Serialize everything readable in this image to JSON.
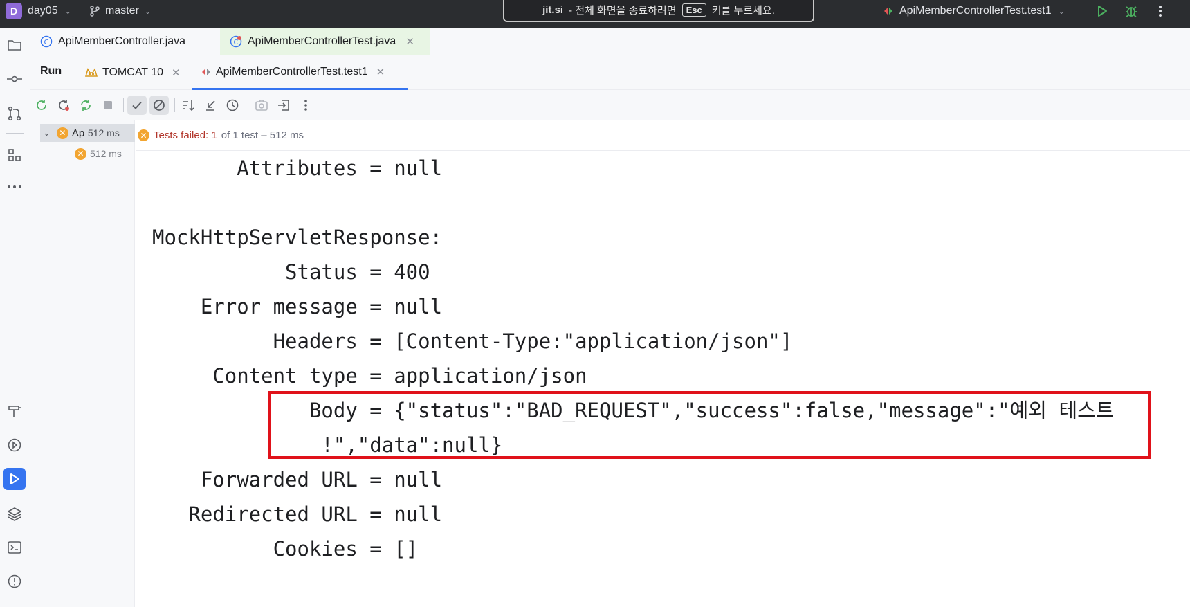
{
  "titlebar": {
    "project_initial": "D",
    "project_name": "day05",
    "branch": "master",
    "fullscreen_notice": {
      "site": "jit.si",
      "before": "- 전체 화면을 종료하려면",
      "key": "Esc",
      "after": "키를 누르세요."
    },
    "run_config": "ApiMemberControllerTest.test1"
  },
  "editor_tabs": [
    {
      "label": "ApiMemberController.java",
      "selected": false
    },
    {
      "label": "ApiMemberControllerTest.java",
      "selected": true
    }
  ],
  "run_panel": {
    "title": "Run",
    "tabs": [
      {
        "label": "TOMCAT 10"
      },
      {
        "label": "ApiMemberControllerTest.test1",
        "selected": true
      }
    ]
  },
  "test_tree": [
    {
      "name": "ApiMemberControllerTest",
      "duration": "512 ms",
      "expanded": true
    },
    {
      "name": "",
      "duration": "512 ms"
    }
  ],
  "status": {
    "failed_label": "Tests failed: 1",
    "rest": "of 1 test – 512 ms"
  },
  "console_lines": [
    "       Attributes = null",
    "",
    "MockHttpServletResponse:",
    "           Status = 400",
    "    Error message = null",
    "          Headers = [Content-Type:\"application/json\"]",
    "     Content type = application/json",
    "             Body = {\"status\":\"BAD_REQUEST\",\"success\":false,\"message\":\"예외 테스트",
    "              !\",\"data\":null}",
    "    Forwarded URL = null",
    "   Redirected URL = null",
    "          Cookies = []"
  ],
  "colors": {
    "accent": "#3574f0",
    "fail": "#f2a531",
    "highlight_box": "#e0121a",
    "run_green": "#4cb060"
  }
}
